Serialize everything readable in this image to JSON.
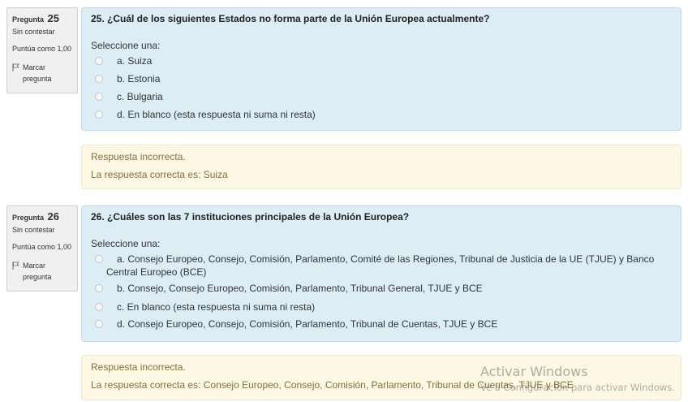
{
  "questions": [
    {
      "label": "Pregunta",
      "number": "25",
      "status": "Sin contestar",
      "score": "Puntúa como 1,00",
      "flag_label": "Marcar pregunta",
      "text": "25. ¿Cuál de los siguientes Estados no forma parte de la Unión Europea actualmente?",
      "prompt": "Seleccione una:",
      "options": [
        "a. Suiza",
        "b. Estonia",
        "c. Bulgaria",
        "d. En blanco (esta respuesta ni suma ni resta)"
      ],
      "feedback_result": "Respuesta incorrecta.",
      "feedback_correct": "La respuesta correcta es: Suiza"
    },
    {
      "label": "Pregunta",
      "number": "26",
      "status": "Sin contestar",
      "score": "Puntúa como 1,00",
      "flag_label": "Marcar pregunta",
      "text": "26. ¿Cuáles son las 7 instituciones principales de la Unión Europea?",
      "prompt": "Seleccione una:",
      "options": [
        "a. Consejo Europeo, Consejo, Comisión, Parlamento, Comité de las Regiones, Tribunal de Justicia de la UE (TJUE) y Banco Central Europeo (BCE)",
        "b. Consejo, Consejo Europeo, Comisión, Parlamento, Tribunal General, TJUE y BCE",
        "c. En blanco (esta respuesta ni suma ni resta)",
        "d. Consejo Europeo, Consejo, Comisión, Parlamento, Tribunal de Cuentas, TJUE y BCE"
      ],
      "feedback_result": "Respuesta incorrecta.",
      "feedback_correct": "La respuesta correcta es: Consejo Europeo, Consejo, Comisión, Parlamento, Tribunal de Cuentas, TJUE y BCE"
    }
  ],
  "watermark": {
    "title": "Activar Windows",
    "subtitle": "Ve a Configuración para activar Windows."
  },
  "colors": {
    "question_bg": "#dcedf5",
    "feedback_bg": "#fcf8e3",
    "feedback_text": "#8a6d3b",
    "info_bg": "#f0f0f0"
  }
}
